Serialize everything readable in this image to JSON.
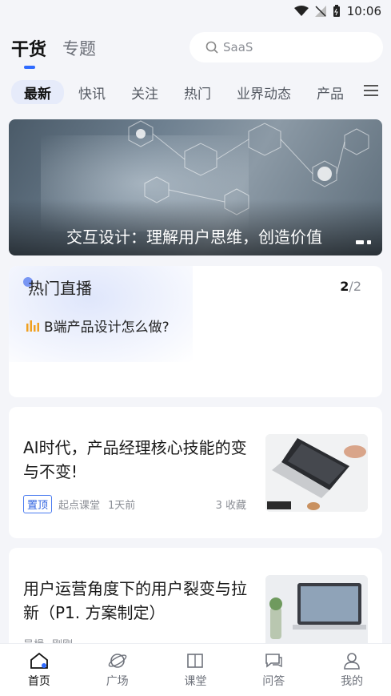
{
  "status_bar": {
    "time": "10:06"
  },
  "header": {
    "tabs": [
      {
        "label": "干货",
        "active": true
      },
      {
        "label": "专题",
        "active": false
      }
    ],
    "search": {
      "placeholder": "SaaS"
    }
  },
  "categories": [
    "最新",
    "快讯",
    "关注",
    "热门",
    "业界动态",
    "产品"
  ],
  "banner": {
    "title": "交互设计：理解用户思维，创造价值"
  },
  "live": {
    "title": "热门直播",
    "page_current": "2",
    "page_total": "/2",
    "item": "B端产品设计怎么做?"
  },
  "articles": [
    {
      "title": "AI时代，产品经理核心技能的变与不变!",
      "badge": "置顶",
      "source": "起点课堂",
      "time": "1天前",
      "favorites": "3 收藏"
    },
    {
      "title": "用户运营角度下的用户裂变与拉新（P1. 方案制定）",
      "source": "吴楫",
      "author": "刚刚"
    }
  ],
  "bottom_nav": [
    {
      "label": "首页",
      "icon": "home-icon",
      "active": true
    },
    {
      "label": "广场",
      "icon": "planet-icon",
      "active": false
    },
    {
      "label": "课堂",
      "icon": "book-icon",
      "active": false
    },
    {
      "label": "问答",
      "icon": "chat-icon",
      "active": false
    },
    {
      "label": "我的",
      "icon": "user-icon",
      "active": false
    }
  ],
  "colors": {
    "accent": "#2f6bff",
    "badge": "#2f63e0",
    "live_icon": "#f0a020"
  }
}
